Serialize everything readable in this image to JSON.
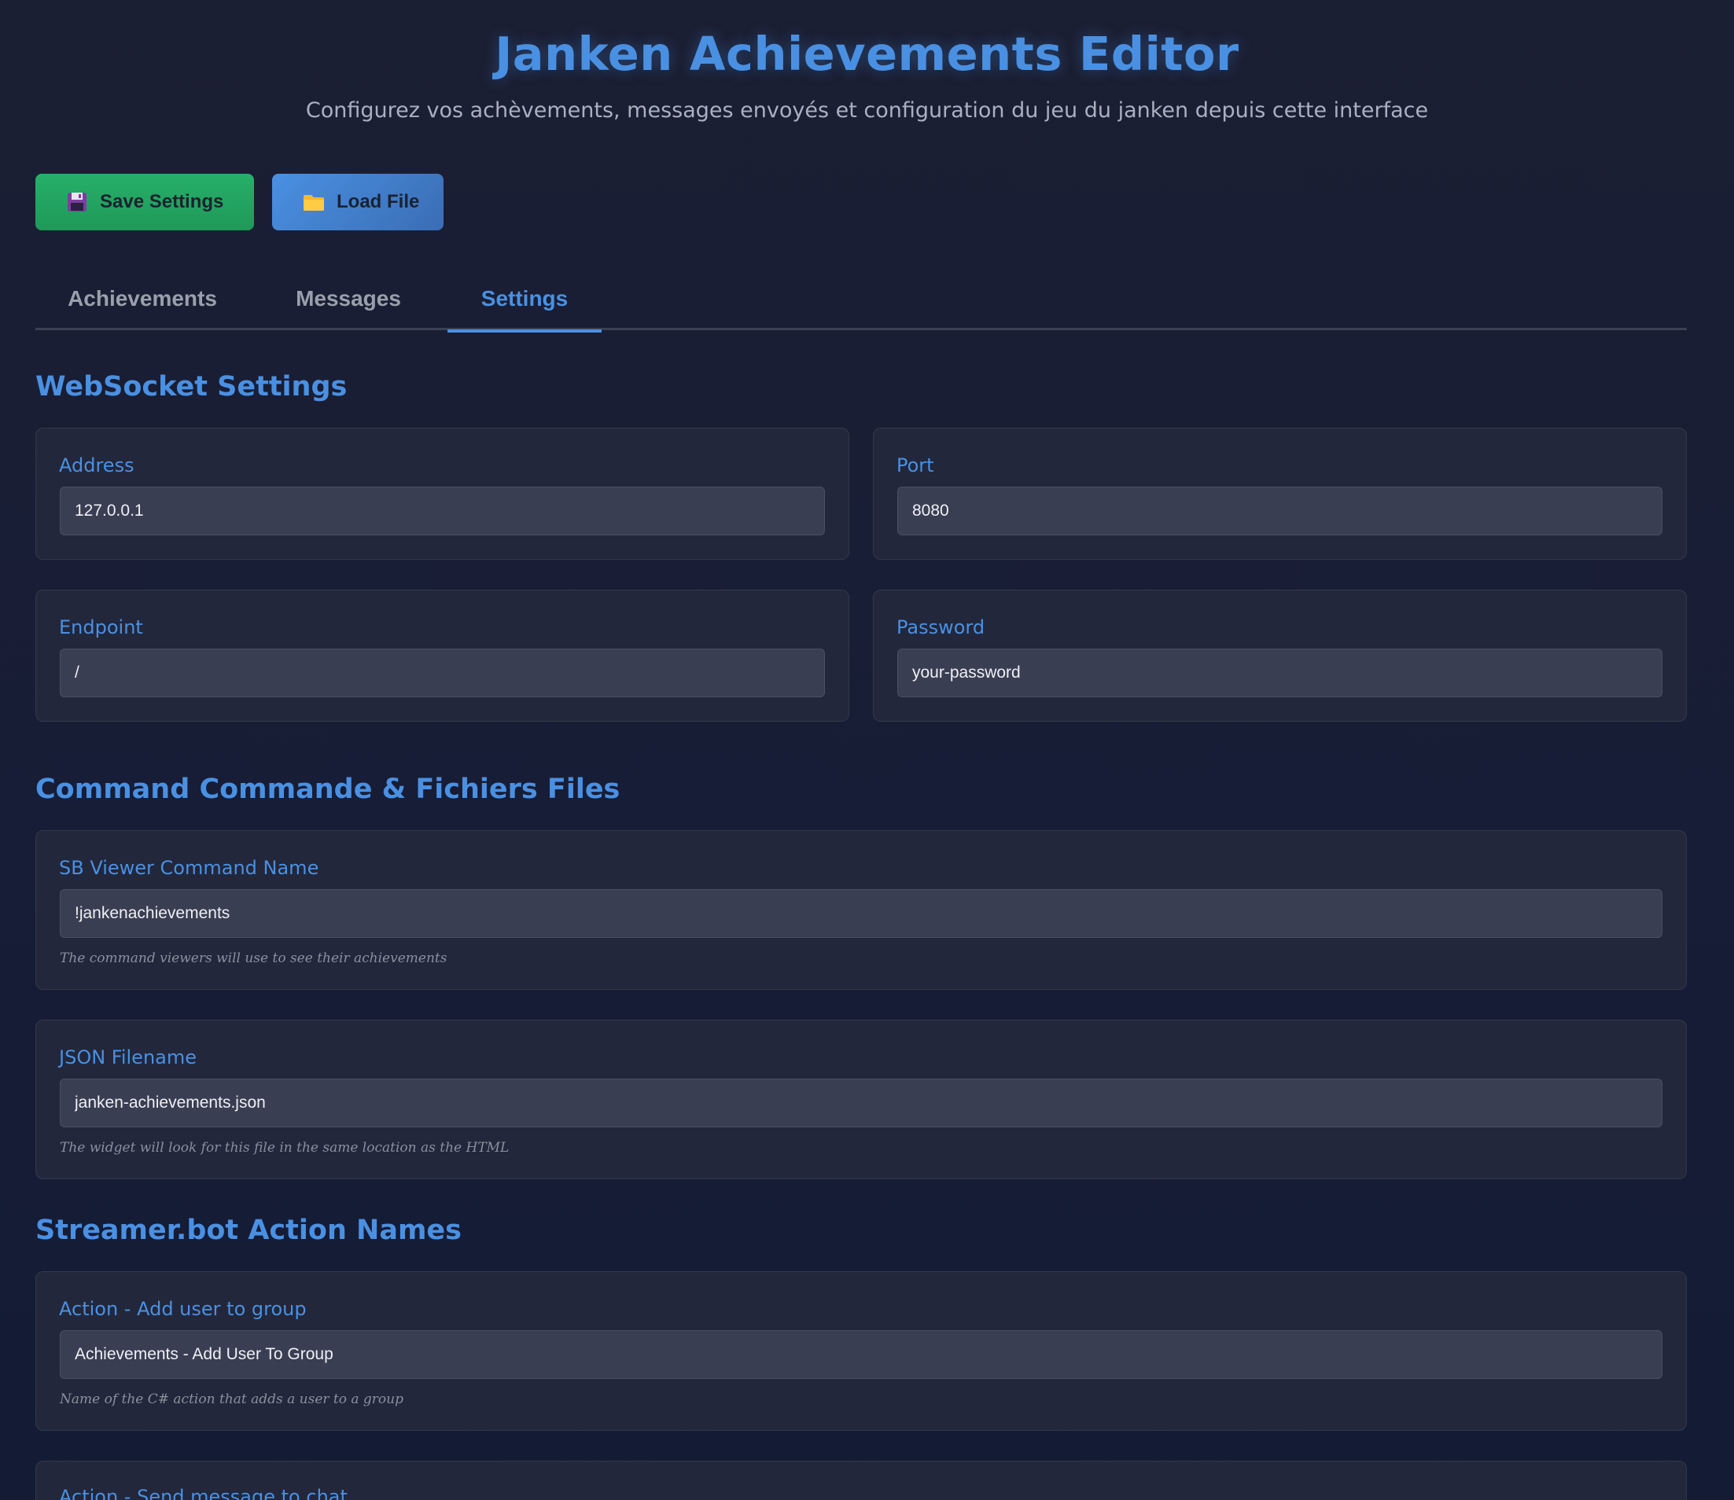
{
  "header": {
    "title": "Janken Achievements Editor",
    "subtitle": "Configurez vos achèvements, messages envoyés et configuration du jeu du janken depuis cette interface"
  },
  "toolbar": {
    "save": {
      "label": "Save Settings",
      "icon": "floppy-disk-icon",
      "color": "#23a661"
    },
    "load": {
      "label": "Load File",
      "icon": "folder-icon",
      "color": "#4a90e2"
    }
  },
  "tabs": [
    {
      "label": "Achievements",
      "active": false
    },
    {
      "label": "Messages",
      "active": false
    },
    {
      "label": "Settings",
      "active": true
    }
  ],
  "colors": {
    "accent": "#4a90e2",
    "background": "#1b1f33",
    "card": "#22273b",
    "input": "#3a3e52"
  },
  "sections": {
    "websocket": {
      "title": "WebSocket Settings",
      "fields": {
        "address": {
          "label": "Address",
          "value": "127.0.0.1"
        },
        "port": {
          "label": "Port",
          "value": "8080"
        },
        "endpoint": {
          "label": "Endpoint",
          "value": "/"
        },
        "password": {
          "label": "Password",
          "value": "your-password"
        }
      }
    },
    "command_files": {
      "title": "Command Commande & Fichiers Files",
      "fields": {
        "command_name": {
          "label": "SB Viewer Command Name",
          "value": "!jankenachievements",
          "help": "The command viewers will use to see their achievements"
        },
        "json_filename": {
          "label": "JSON Filename",
          "value": "janken-achievements.json",
          "help": "The widget will look for this file in the same location as the HTML"
        }
      }
    },
    "actions": {
      "title": "Streamer.bot Action Names",
      "fields": {
        "add_user": {
          "label": "Action - Add user to group",
          "value": "Achievements - Add User To Group",
          "help": "Name of the C# action that adds a user to a group"
        },
        "send_message": {
          "label": "Action - Send message to chat"
        }
      }
    }
  }
}
